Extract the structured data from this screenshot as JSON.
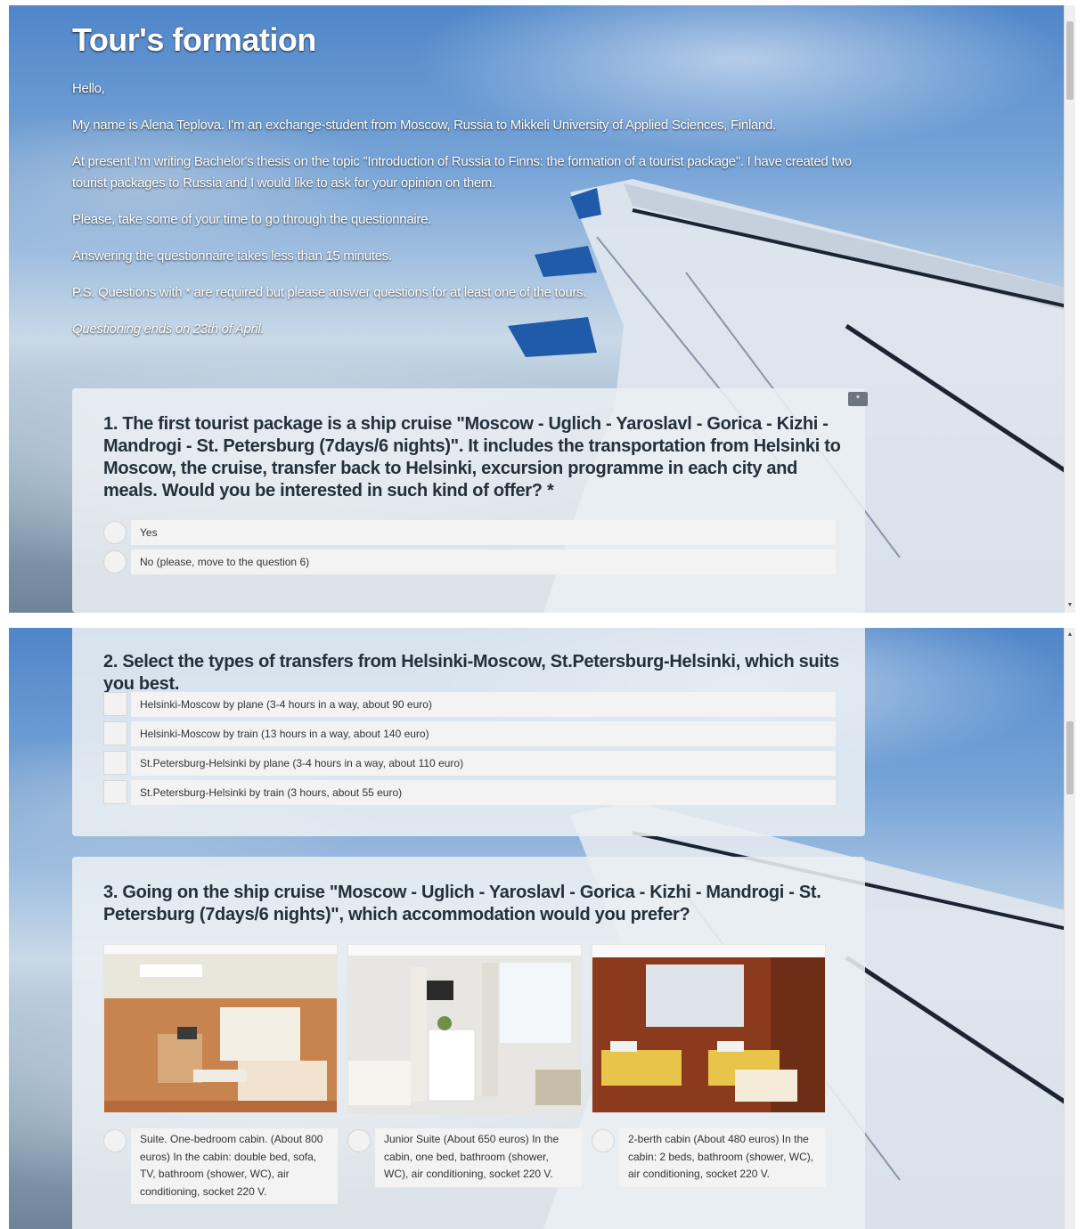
{
  "intro": {
    "title": "Tour's formation",
    "greeting": "Hello,",
    "p1": "My name is Alena Teplova. I'm an exchange-student from Moscow, Russia to Mikkeli University of Applied Sciences, Finland.",
    "p2": "At present I'm writing Bachelor's thesis on the topic \"Introduction of Russia to Finns: the formation of a tourist package\". I have created two tourist packages to Russia and I would like to ask for your opinion on them.",
    "p3": "Please, take some of your time to go through the questionnaire.",
    "p4": "Answering the questionnaire takes less than 15 minutes.",
    "p5": "P.S. Questions with * are required but please answer questions for at least one of the tours.",
    "p6": "Questioning ends on 23th of April."
  },
  "q1": {
    "title": "1. The first tourist package is a ship cruise \"Moscow - Uglich - Yaroslavl - Gorica - Kizhi - Mandrogi - St. Petersburg (7days/6 nights)\". It includes the transportation from Helsinki to Moscow, the cruise, transfer back to Helsinki, excursion programme in each city and meals. Would you be interested in such kind of offer? *",
    "badge": "*",
    "options": [
      "Yes",
      "No (please, move to the question 6)"
    ]
  },
  "q2": {
    "title": "2. Select the types of transfers from Helsinki-Moscow, St.Petersburg-Helsinki, which suits you best.",
    "options": [
      "Helsinki-Moscow by plane (3-4 hours in a way, about 90 euro)",
      "Helsinki-Moscow by train (13 hours in a way, about 140 euro)",
      "St.Petersburg-Helsinki by plane (3-4 hours in a way, about 110 euro)",
      "St.Petersburg-Helsinki by train (3 hours, about 55 euro)"
    ]
  },
  "q3": {
    "title": "3. Going on the ship cruise \"Moscow - Uglich - Yaroslavl - Gorica - Kizhi - Mandrogi - St. Petersburg (7days/6 nights)\", which accommodation would you prefer?",
    "options": [
      "Suite. One-bedroom cabin. (About 800 euros) In the cabin: double bed, sofa, TV, bathroom (shower, WC), air conditioning, socket 220 V.",
      "Junior Suite (About 650 euros) In the cabin, one bed, bathroom (shower, WC), air conditioning, socket 220 V.",
      "2-berth cabin (About 480 euros) In the cabin: 2 beds, bathroom (shower, WC), air conditioning, socket 220 V."
    ]
  },
  "scrollbar": {
    "up_arrow": "▲",
    "down_arrow": "▼"
  },
  "colors": {
    "card": "#ebeff3",
    "title": "#23303b",
    "badge": "#6d7680"
  }
}
